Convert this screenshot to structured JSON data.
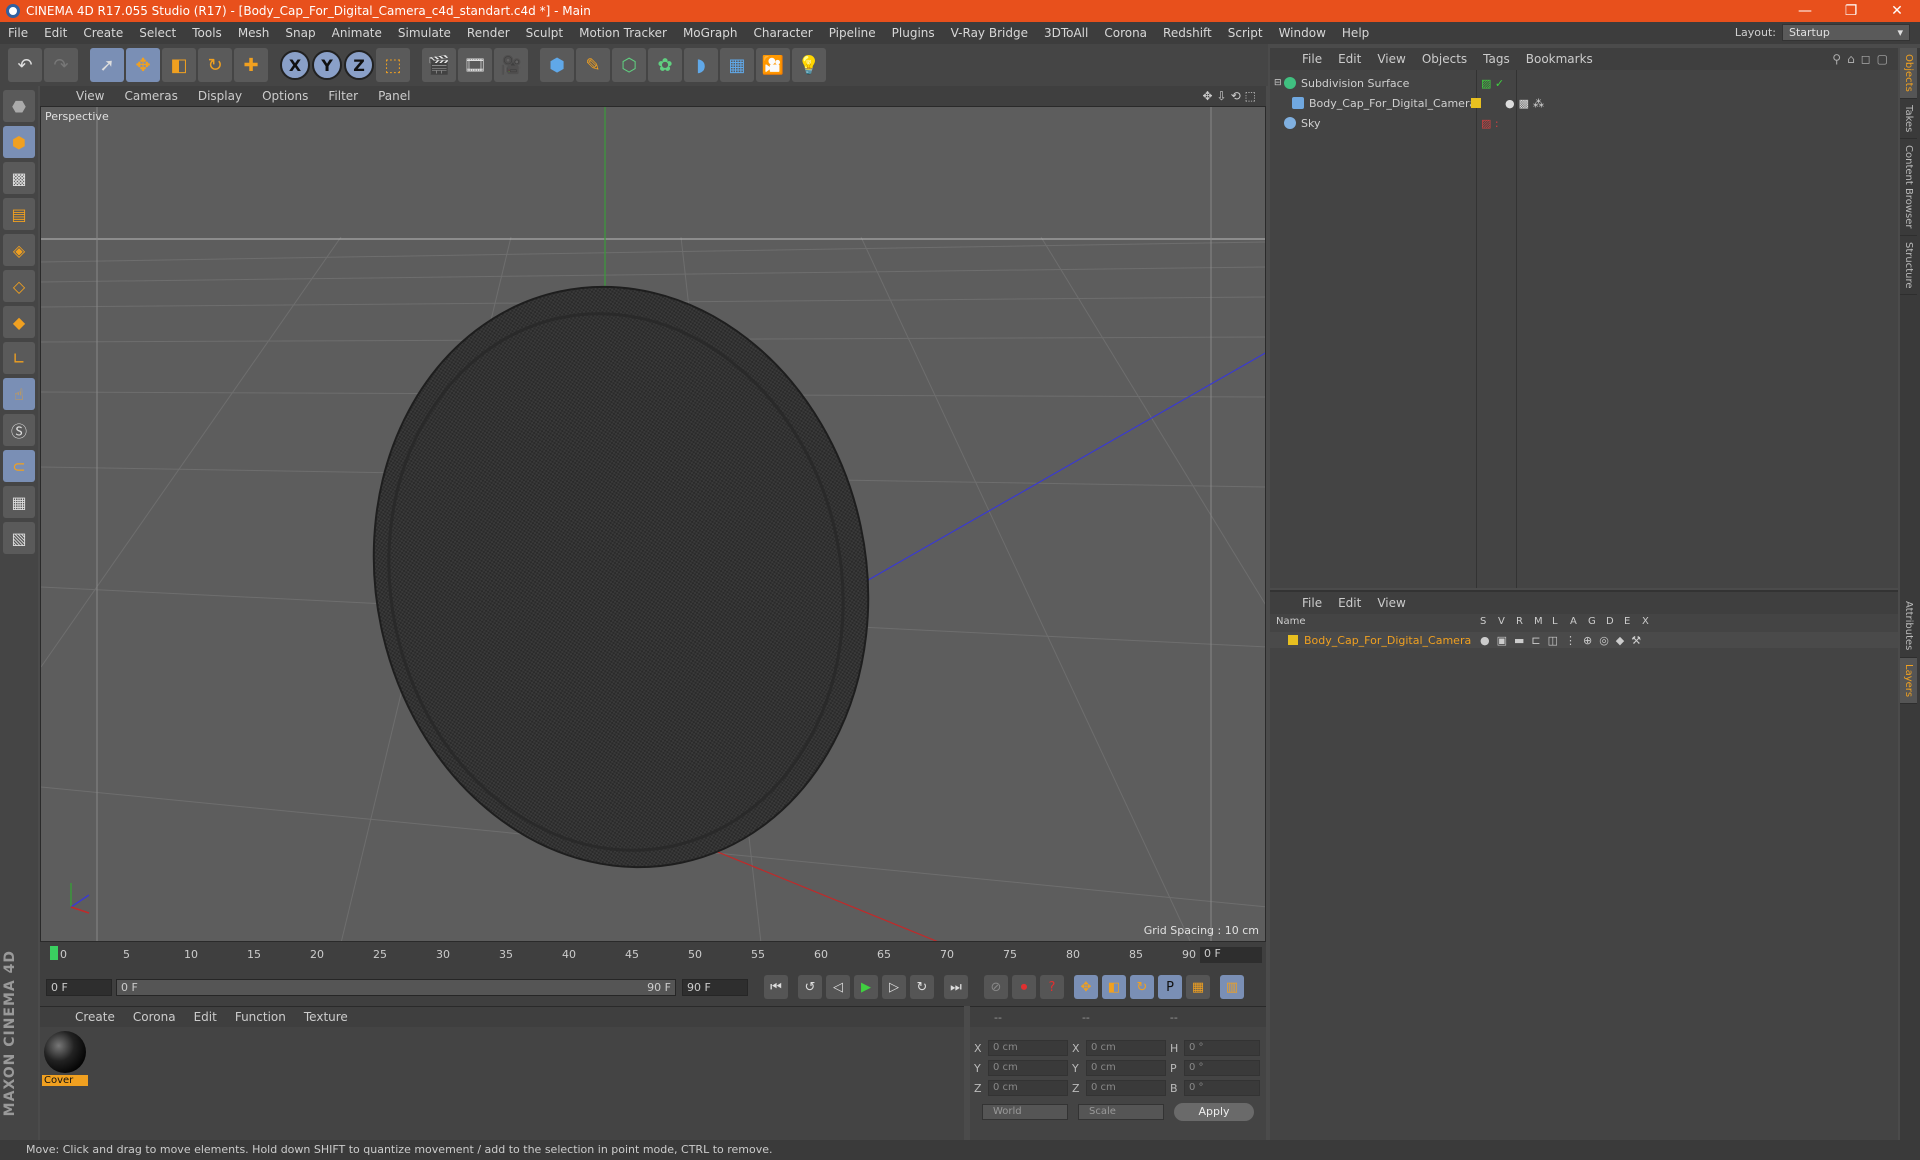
{
  "window": {
    "title": "CINEMA 4D R17.055 Studio (R17) - [Body_Cap_For_Digital_Camera_c4d_standart.c4d *] - Main",
    "minimize": "—",
    "maximize": "❐",
    "close": "✕"
  },
  "menubar": {
    "items": [
      "File",
      "Edit",
      "Create",
      "Select",
      "Tools",
      "Mesh",
      "Snap",
      "Animate",
      "Simulate",
      "Render",
      "Sculpt",
      "Motion Tracker",
      "MoGraph",
      "Character",
      "Pipeline",
      "Plugins",
      "V-Ray Bridge",
      "3DToAll",
      "Corona",
      "Redshift",
      "Script",
      "Window",
      "Help"
    ],
    "layout_label": "Layout:",
    "layout_value": "Startup"
  },
  "viewport": {
    "menu": [
      "View",
      "Cameras",
      "Display",
      "Options",
      "Filter",
      "Panel"
    ],
    "camera_label": "Perspective",
    "grid_spacing": "Grid Spacing : 10 cm"
  },
  "timeline": {
    "ticks": [
      "0",
      "5",
      "10",
      "15",
      "20",
      "25",
      "30",
      "35",
      "40",
      "45",
      "50",
      "55",
      "60",
      "65",
      "70",
      "75",
      "80",
      "85",
      "90"
    ],
    "current_frame": "0 F"
  },
  "playback": {
    "start_field": "0 F",
    "range_start": "0 F",
    "range_end": "90 F",
    "end_field": "90 F"
  },
  "material_manager": {
    "menu": [
      "Create",
      "Corona",
      "Edit",
      "Function",
      "Texture"
    ],
    "material_name": "Cover"
  },
  "coordinates": {
    "header": [
      "--",
      "--",
      "--"
    ],
    "rows": [
      {
        "l1": "X",
        "v1": "0 cm",
        "l2": "X",
        "v2": "0 cm",
        "l3": "H",
        "v3": "0 °"
      },
      {
        "l1": "Y",
        "v1": "0 cm",
        "l2": "Y",
        "v2": "0 cm",
        "l3": "P",
        "v3": "0 °"
      },
      {
        "l1": "Z",
        "v1": "0 cm",
        "l2": "Z",
        "v2": "0 cm",
        "l3": "B",
        "v3": "0 °"
      }
    ],
    "space": "World",
    "mode": "Scale",
    "apply": "Apply"
  },
  "object_manager": {
    "menu": [
      "File",
      "Edit",
      "View",
      "Objects",
      "Tags",
      "Bookmarks"
    ],
    "objects": [
      {
        "name": "Subdivision Surface",
        "color": "#40c080"
      },
      {
        "name": "Body_Cap_For_Digital_Camera",
        "color": "#70a8e0"
      },
      {
        "name": "Sky",
        "color": "#80b0e0"
      }
    ]
  },
  "layer_manager": {
    "menu": [
      "File",
      "Edit",
      "View"
    ],
    "columns": [
      "Name",
      "S",
      "V",
      "R",
      "M",
      "L",
      "A",
      "G",
      "D",
      "E",
      "X"
    ],
    "layer_name": "Body_Cap_For_Digital_Camera",
    "layer_color": "#e8c020"
  },
  "right_tabs": [
    "Objects",
    "Takes",
    "Content Browser",
    "Structure",
    "Attributes",
    "Layers"
  ],
  "status": "Move: Click and drag to move elements. Hold down SHIFT to quantize movement / add to the selection in point mode, CTRL to remove.",
  "branding": "MAXON CINEMA 4D"
}
